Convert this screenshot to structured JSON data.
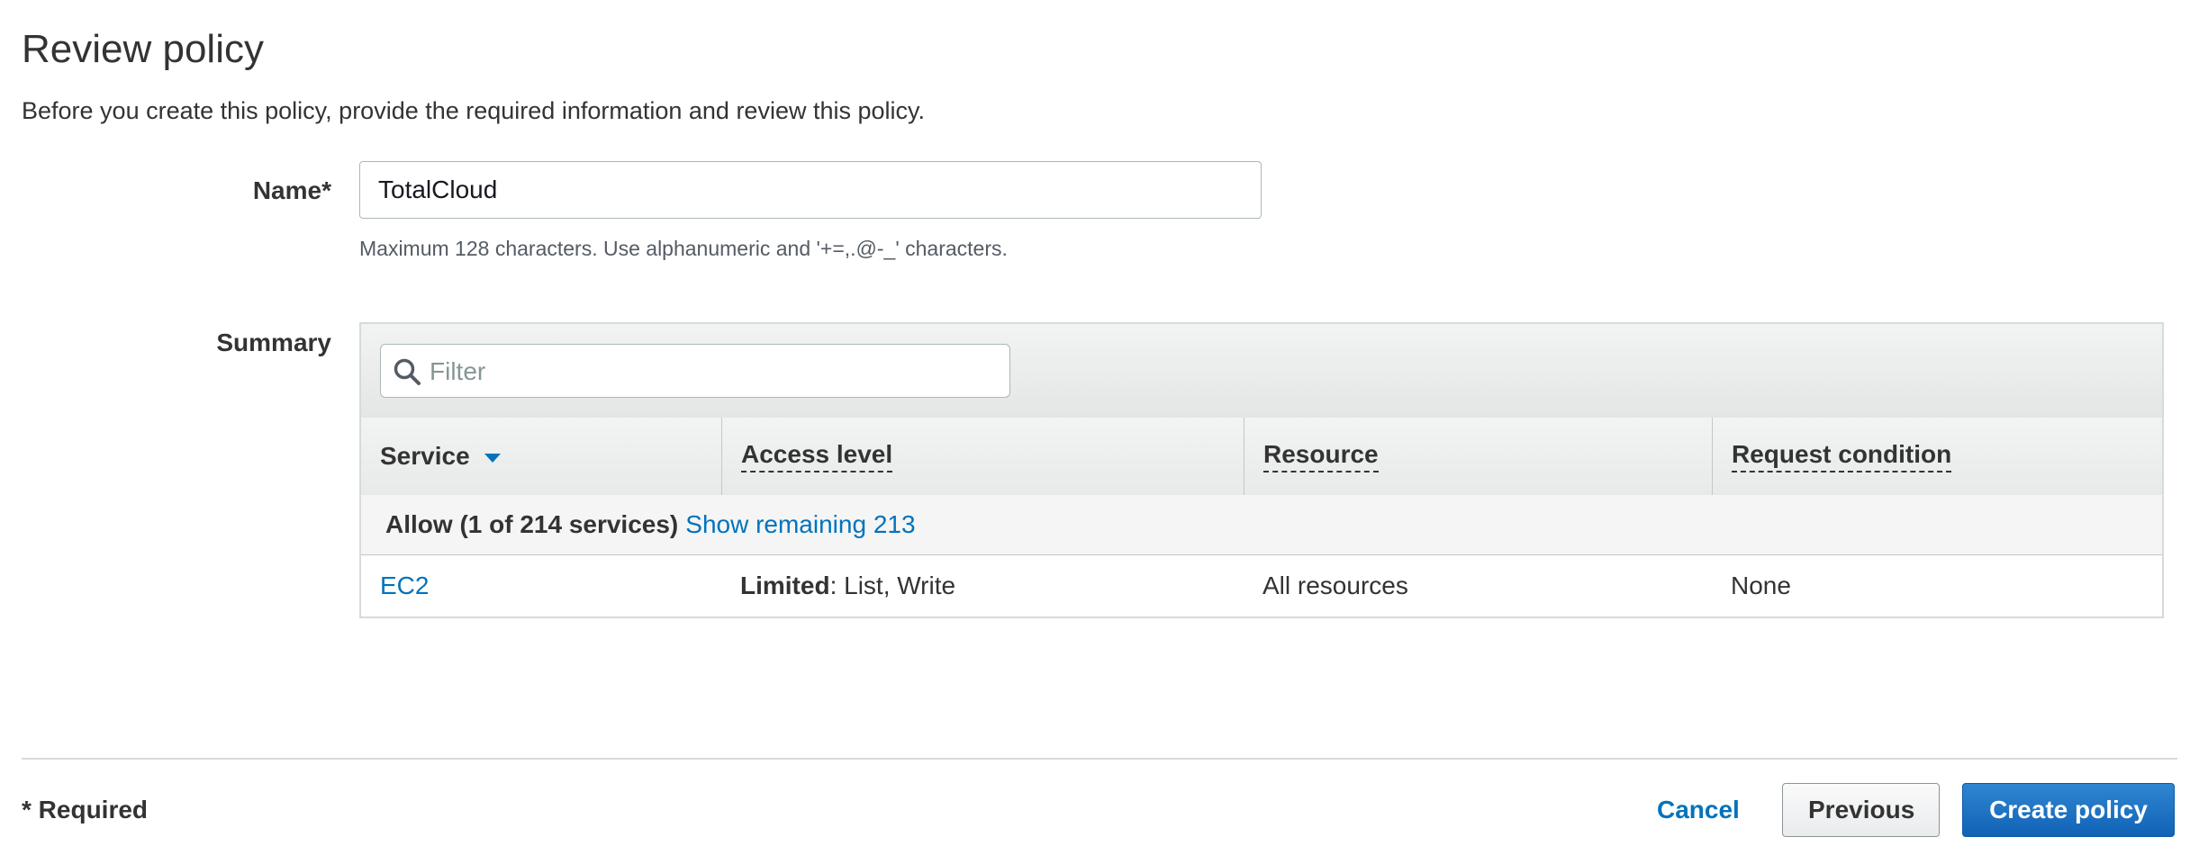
{
  "page": {
    "title": "Review policy",
    "description": "Before you create this policy, provide the required information and review this policy."
  },
  "name_field": {
    "label": "Name*",
    "value": "TotalCloud",
    "hint": "Maximum 128 characters. Use alphanumeric and '+=,.@-_' characters."
  },
  "summary": {
    "label": "Summary",
    "filter_placeholder": "Filter",
    "columns": {
      "service": "Service",
      "access_level": "Access level",
      "resource": "Resource",
      "request_condition": "Request condition"
    },
    "group": {
      "label": "Allow (1 of 214 services)",
      "link": "Show remaining 213"
    },
    "rows": [
      {
        "service": "EC2",
        "access_level_bold": "Limited",
        "access_level_rest": ": List, Write",
        "resource": "All resources",
        "request_condition": "None"
      }
    ]
  },
  "footer": {
    "required_note": "* Required",
    "cancel_label": "Cancel",
    "previous_label": "Previous",
    "create_label": "Create policy"
  },
  "icons": {
    "filter": "search-icon",
    "sort": "caret-down-icon"
  },
  "colors": {
    "link": "#0073bb",
    "primary_button": "#1162b6"
  }
}
